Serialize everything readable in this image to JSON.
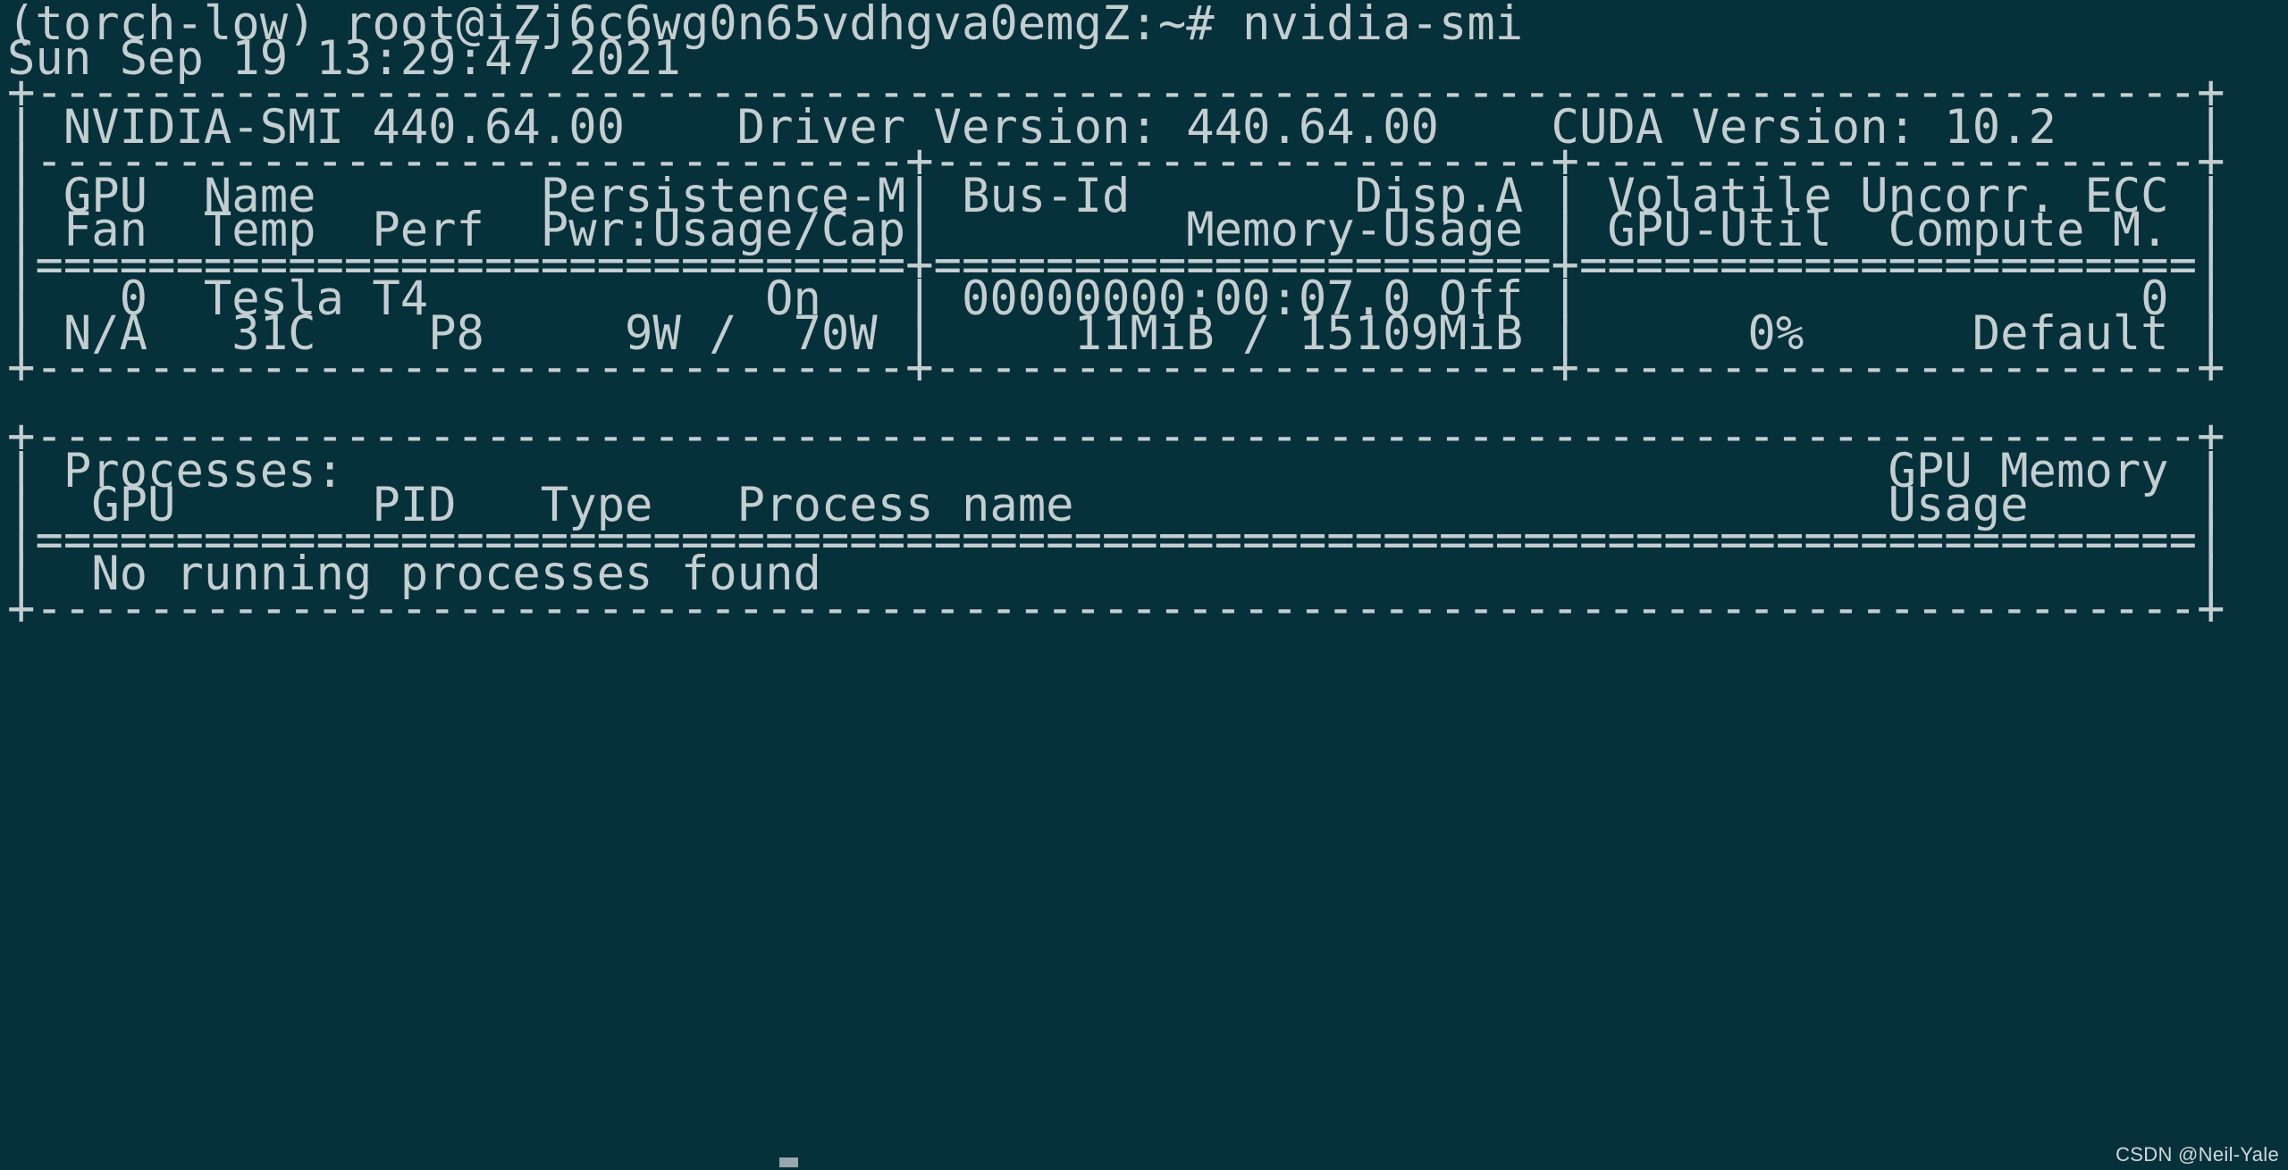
{
  "terminal": {
    "background_color": "#06303a",
    "foreground_color": "#c3ced1",
    "prompt_line": "(torch-low) root@iZj6c6wg0n65vdhgva0emgZ:~# nvidia-smi",
    "prompt": {
      "env": "(torch-low)",
      "user_host": "root@iZj6c6wg0n65vdhgva0emgZ",
      "path": "~",
      "sigil": "#",
      "command": "nvidia-smi"
    },
    "timestamp": "Sun Sep 19 13:29:47 2021",
    "watermark": "CSDN @Neil-Yale"
  },
  "nvidia_smi": {
    "header": {
      "smi_version_label": "NVIDIA-SMI",
      "smi_version": "440.64.00",
      "driver_version_label": "Driver Version:",
      "driver_version": "440.64.00",
      "cuda_version_label": "CUDA Version:",
      "cuda_version": "10.2"
    },
    "column_headers_row1": [
      "GPU",
      "Name",
      "Persistence-M",
      "Bus-Id",
      "Disp.A",
      "Volatile Uncorr. ECC"
    ],
    "column_headers_row2": [
      "Fan",
      "Temp",
      "Perf",
      "Pwr:Usage/Cap",
      "Memory-Usage",
      "GPU-Util",
      "Compute M."
    ],
    "gpus": [
      {
        "index": "0",
        "name": "Tesla T4",
        "persistence_m": "On",
        "bus_id": "00000000:00:07.0",
        "disp_a": "Off",
        "ecc": "0",
        "fan": "N/A",
        "temp": "31C",
        "perf": "P8",
        "pwr_usage": "9W",
        "pwr_cap": "70W",
        "memory_used": "11MiB",
        "memory_total": "15109MiB",
        "gpu_util": "0%",
        "compute_m": "Default"
      }
    ],
    "processes": {
      "title": "Processes:",
      "gpu_memory_header": "GPU Memory",
      "usage_header": "Usage",
      "columns": [
        "GPU",
        "PID",
        "Type",
        "Process name"
      ],
      "empty_message": "No running processes found"
    }
  },
  "raw_lines": [
    "(torch-low) root@iZj6c6wg0n65vdhgva0emgZ:~# nvidia-smi",
    "Sun Sep 19 13:29:47 2021",
    "+-----------------------------------------------------------------------------+",
    "| NVIDIA-SMI 440.64.00    Driver Version: 440.64.00    CUDA Version: 10.2     |",
    "|-------------------------------+----------------------+----------------------+",
    "| GPU  Name        Persistence-M| Bus-Id        Disp.A | Volatile Uncorr. ECC |",
    "| Fan  Temp  Perf  Pwr:Usage/Cap|         Memory-Usage | GPU-Util  Compute M. |",
    "|===============================+======================+======================|",
    "|   0  Tesla T4            On   | 00000000:00:07.0 Off |                    0 |",
    "| N/A   31C    P8     9W /  70W |     11MiB / 15109MiB |      0%      Default |",
    "+-------------------------------+----------------------+----------------------+",
    "",
    "+-----------------------------------------------------------------------------+",
    "| Processes:                                                       GPU Memory |",
    "|  GPU       PID   Type   Process name                             Usage      |",
    "|=============================================================================|",
    "|  No running processes found                                                 |",
    "+-----------------------------------------------------------------------------+"
  ]
}
